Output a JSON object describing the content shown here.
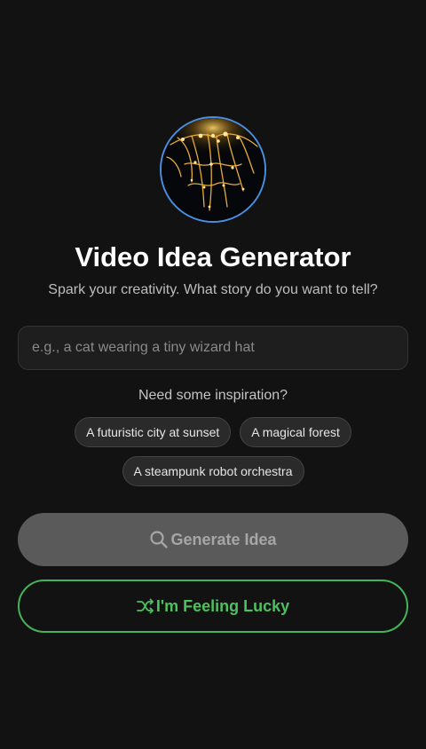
{
  "header": {
    "logo_icon": "glowing-network-icon",
    "title": "Video Idea Generator",
    "subtitle": "Spark your creativity. What story do you want to tell?"
  },
  "prompt_input": {
    "value": "",
    "placeholder": "e.g., a cat wearing a tiny wizard hat"
  },
  "inspiration": {
    "heading": "Need some inspiration?",
    "chips": [
      "A futuristic city at sunset",
      "A magical forest",
      "A steampunk robot orchestra"
    ]
  },
  "actions": {
    "generate_label": "Generate Idea",
    "generate_icon": "search-icon",
    "lucky_label": "I'm Feeling Lucky",
    "lucky_icon": "shuffle-icon"
  },
  "colors": {
    "background": "#121212",
    "logo_ring": "#4a8fe0",
    "generate_bg": "#5a5a5a",
    "lucky_accent": "#45b35a"
  }
}
